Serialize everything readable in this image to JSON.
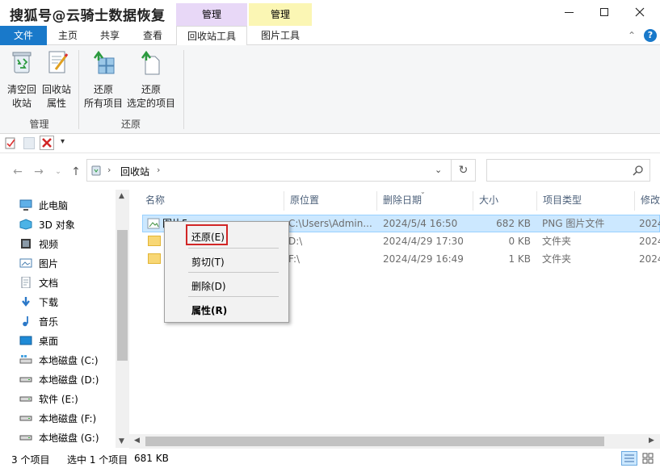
{
  "watermark": "搜狐号@云骑士数据恢复",
  "context_tab_heads": {
    "recycle": "管理",
    "picture": "管理"
  },
  "ribbon_tabs": {
    "file": "文件",
    "home": "主页",
    "share": "共享",
    "view": "查看",
    "recycle": "回收站工具",
    "picture": "图片工具"
  },
  "ribbon": {
    "empty_bin": [
      "清空回",
      "收站"
    ],
    "properties": [
      "回收站",
      "属性"
    ],
    "restore_all": [
      "还原",
      "所有项目"
    ],
    "restore_selected": [
      "还原",
      "选定的项目"
    ],
    "group_manage": "管理",
    "group_restore": "还原"
  },
  "address": {
    "location": "回收站"
  },
  "nav_items": [
    {
      "label": "此电脑",
      "icon": "computer-icon"
    },
    {
      "label": "3D 对象",
      "icon": "3d-objects-icon"
    },
    {
      "label": "视频",
      "icon": "video-icon"
    },
    {
      "label": "图片",
      "icon": "pictures-icon"
    },
    {
      "label": "文档",
      "icon": "documents-icon"
    },
    {
      "label": "下载",
      "icon": "downloads-icon"
    },
    {
      "label": "音乐",
      "icon": "music-icon"
    },
    {
      "label": "桌面",
      "icon": "desktop-icon"
    },
    {
      "label": "本地磁盘 (C:)",
      "icon": "drive-c-icon"
    },
    {
      "label": "本地磁盘 (D:)",
      "icon": "drive-icon"
    },
    {
      "label": "软件 (E:)",
      "icon": "drive-icon"
    },
    {
      "label": "本地磁盘 (F:)",
      "icon": "drive-icon"
    },
    {
      "label": "本地磁盘 (G:)",
      "icon": "drive-icon"
    }
  ],
  "columns": {
    "name": "名称",
    "orig": "原位置",
    "deleted": "删除日期",
    "size": "大小",
    "type": "项目类型",
    "modified": "修改"
  },
  "rows": [
    {
      "name": "图片5",
      "orig": "C:\\Users\\Admin...",
      "deleted": "2024/5/4 16:50",
      "size": "682 KB",
      "type": "PNG 图片文件",
      "modified": "2024"
    },
    {
      "name": "",
      "orig": "D:\\",
      "deleted": "2024/4/29 17:30",
      "size": "0 KB",
      "type": "文件夹",
      "modified": "2024"
    },
    {
      "name": "",
      "orig": "F:\\",
      "deleted": "2024/4/29 16:49",
      "size": "1 KB",
      "type": "文件夹",
      "modified": "2024"
    }
  ],
  "context_menu": {
    "restore": "还原(E)",
    "cut": "剪切(T)",
    "delete": "删除(D)",
    "properties": "属性(R)"
  },
  "status": {
    "count": "3 个项目",
    "selected": "选中 1 个项目",
    "size": "681 KB"
  },
  "colors": {
    "accent": "#1979ca",
    "selection": "#cce8ff",
    "highlight_box": "#d12626"
  }
}
